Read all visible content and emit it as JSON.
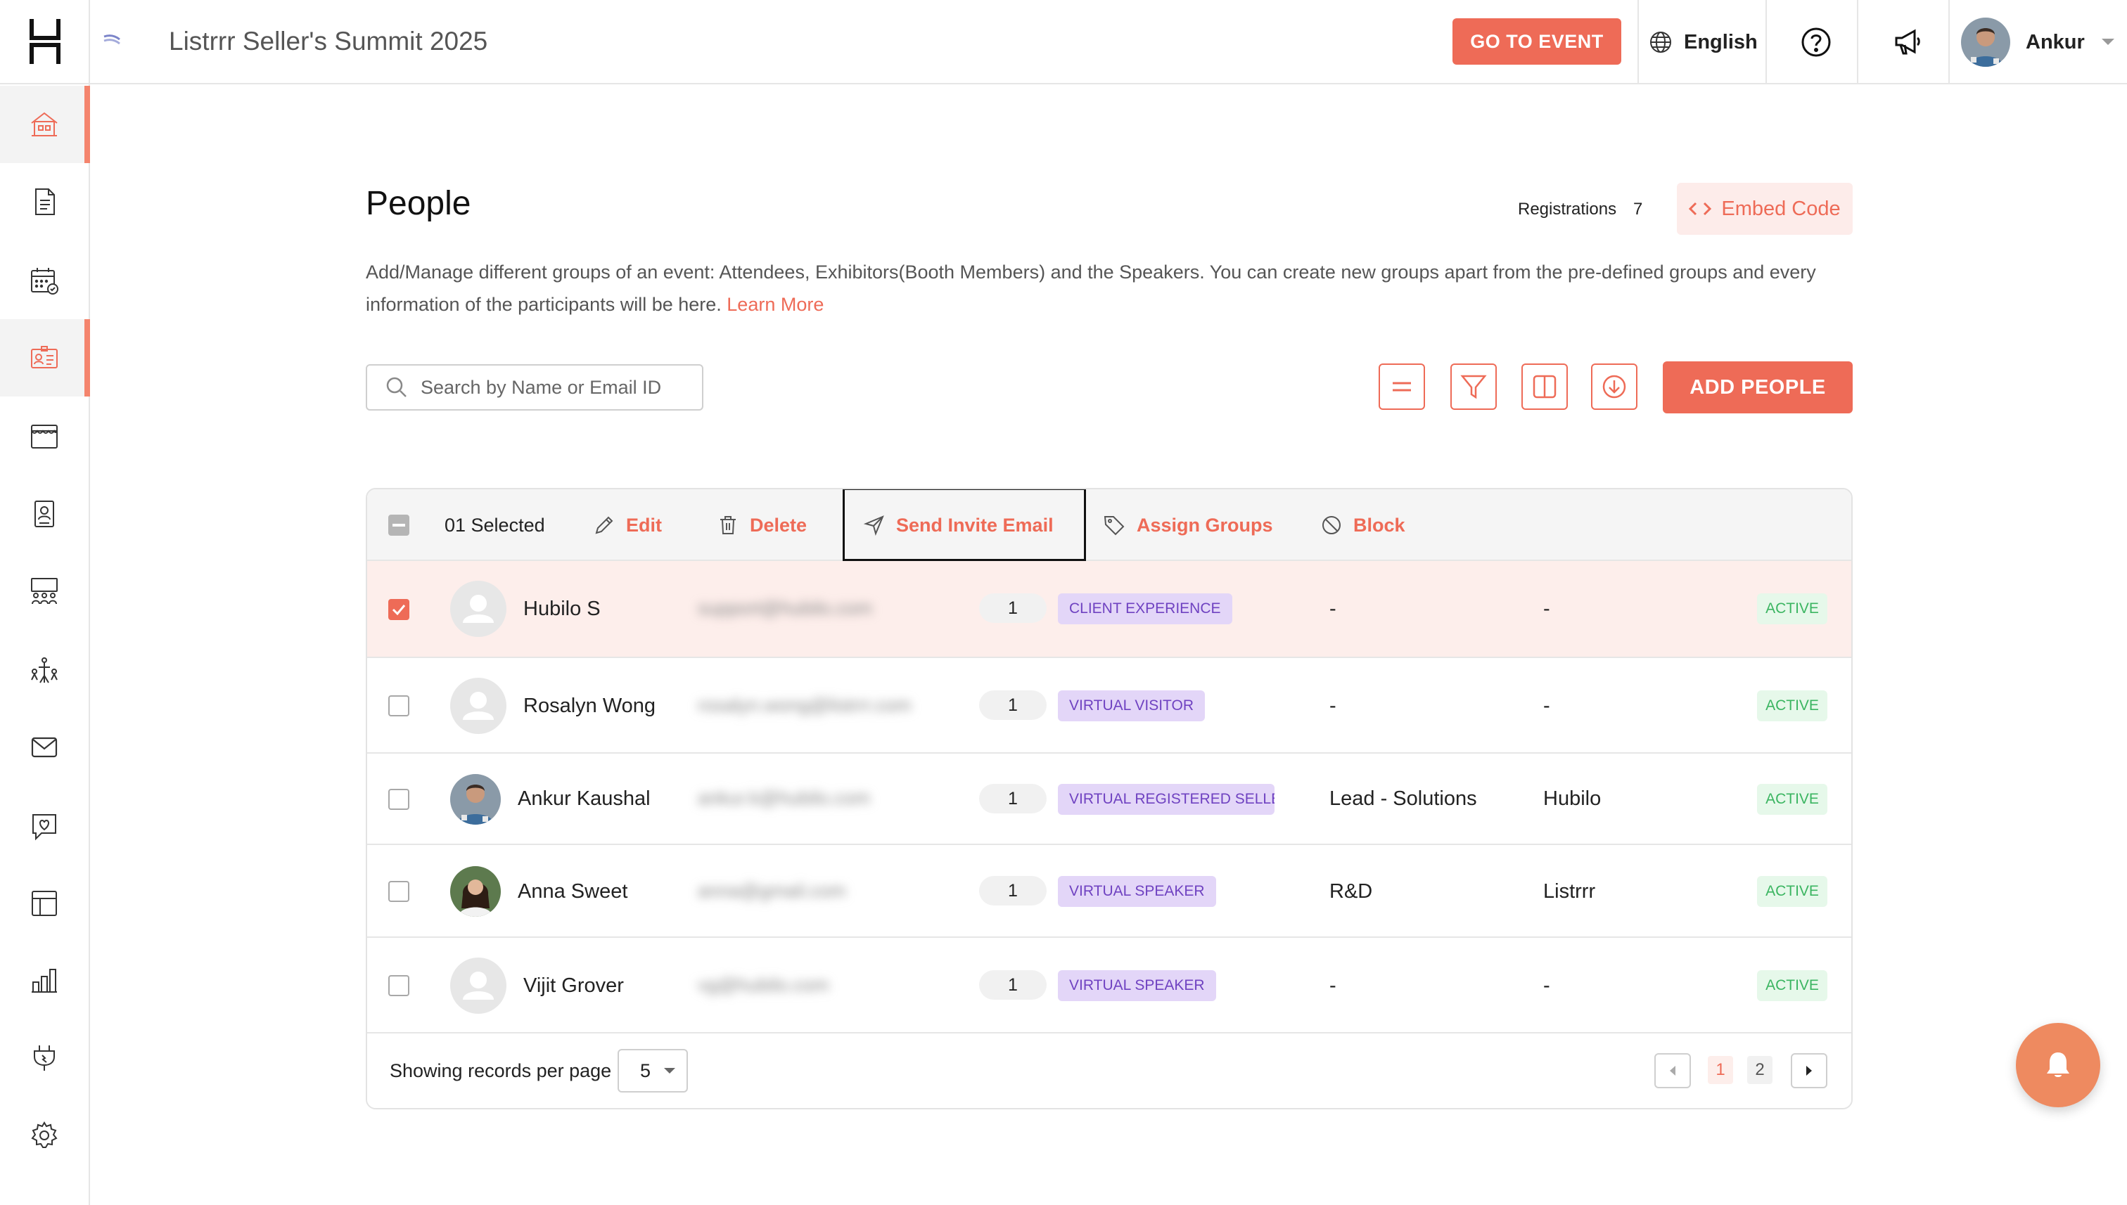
{
  "header": {
    "event_title": "Listrrr Seller's Summit 2025",
    "go_to_event": "GO TO EVENT",
    "language": "English",
    "user_name": "Ankur"
  },
  "page": {
    "title": "People",
    "registrations_label": "Registrations",
    "registrations_count": "7",
    "embed_code": "Embed Code",
    "description": "Add/Manage different groups of an event: Attendees, Exhibitors(Booth Members) and the Speakers. You can create new groups apart from the pre-defined groups and every information of the participants will be here.",
    "learn_more": "Learn More",
    "search_placeholder": "Search by Name or Email ID",
    "add_people": "ADD PEOPLE"
  },
  "actions": {
    "selected": "01 Selected",
    "edit": "Edit",
    "delete": "Delete",
    "send_invite": "Send Invite Email",
    "assign_groups": "Assign Groups",
    "block": "Block"
  },
  "rows": [
    {
      "name": "Hubilo S",
      "email": "support@hubilo.com",
      "count": "1",
      "group": "CLIENT EXPERIENCE",
      "dept": "-",
      "org": "-",
      "status": "ACTIVE"
    },
    {
      "name": "Rosalyn Wong",
      "email": "rosalyn.wong@listrrr.com",
      "count": "1",
      "group": "VIRTUAL VISITOR",
      "dept": "-",
      "org": "-",
      "status": "ACTIVE"
    },
    {
      "name": "Ankur Kaushal",
      "email": "ankur.k@hubilo.com",
      "count": "1",
      "group": "VIRTUAL REGISTERED SELLER",
      "dept": "Lead - Solutions",
      "org": "Hubilo",
      "status": "ACTIVE"
    },
    {
      "name": "Anna Sweet",
      "email": "anna@gmail.com",
      "count": "1",
      "group": "VIRTUAL SPEAKER",
      "dept": "R&D",
      "org": "Listrrr",
      "status": "ACTIVE"
    },
    {
      "name": "Vijit Grover",
      "email": "vg@hubilo.com",
      "count": "1",
      "group": "VIRTUAL SPEAKER",
      "dept": "-",
      "org": "-",
      "status": "ACTIVE"
    }
  ],
  "footer": {
    "per_page_label": "Showing records per page",
    "per_page_value": "5",
    "page_current": "1",
    "page_next": "2"
  },
  "colors": {
    "accent": "#ee6b57",
    "group_badge_bg": "#e3d6f8",
    "group_badge_text": "#6f42c1",
    "status_bg": "#e6f8ea",
    "status_text": "#3bb561",
    "selected_row_bg": "#fdeeeb"
  },
  "icons": {
    "sidebar": [
      "home-icon",
      "document-icon",
      "calendar-icon",
      "people-icon",
      "booth-icon",
      "badge-icon",
      "audience-icon",
      "networking-icon",
      "mail-icon",
      "engagement-icon",
      "layout-icon",
      "analytics-icon",
      "integrations-icon",
      "settings-icon"
    ]
  }
}
